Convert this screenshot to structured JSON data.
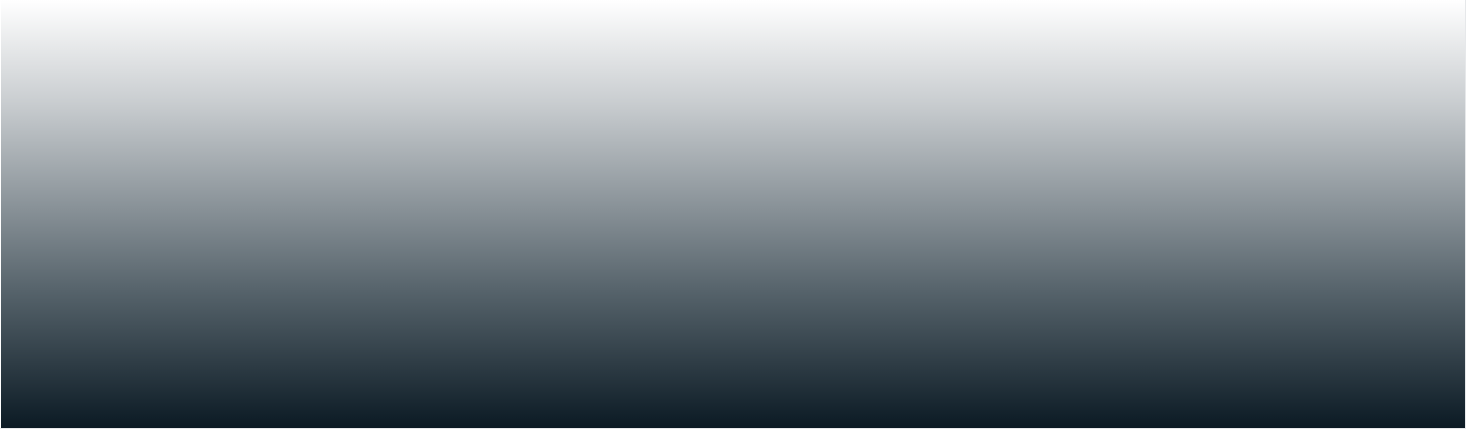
{
  "colors": {
    "top": "#ffffff",
    "upper_mid": "#c9cdd0",
    "mid": "#8a9399",
    "lower_mid": "#56636b",
    "bottom": "#0b1a24",
    "frame_border": "#e6e8ea"
  }
}
